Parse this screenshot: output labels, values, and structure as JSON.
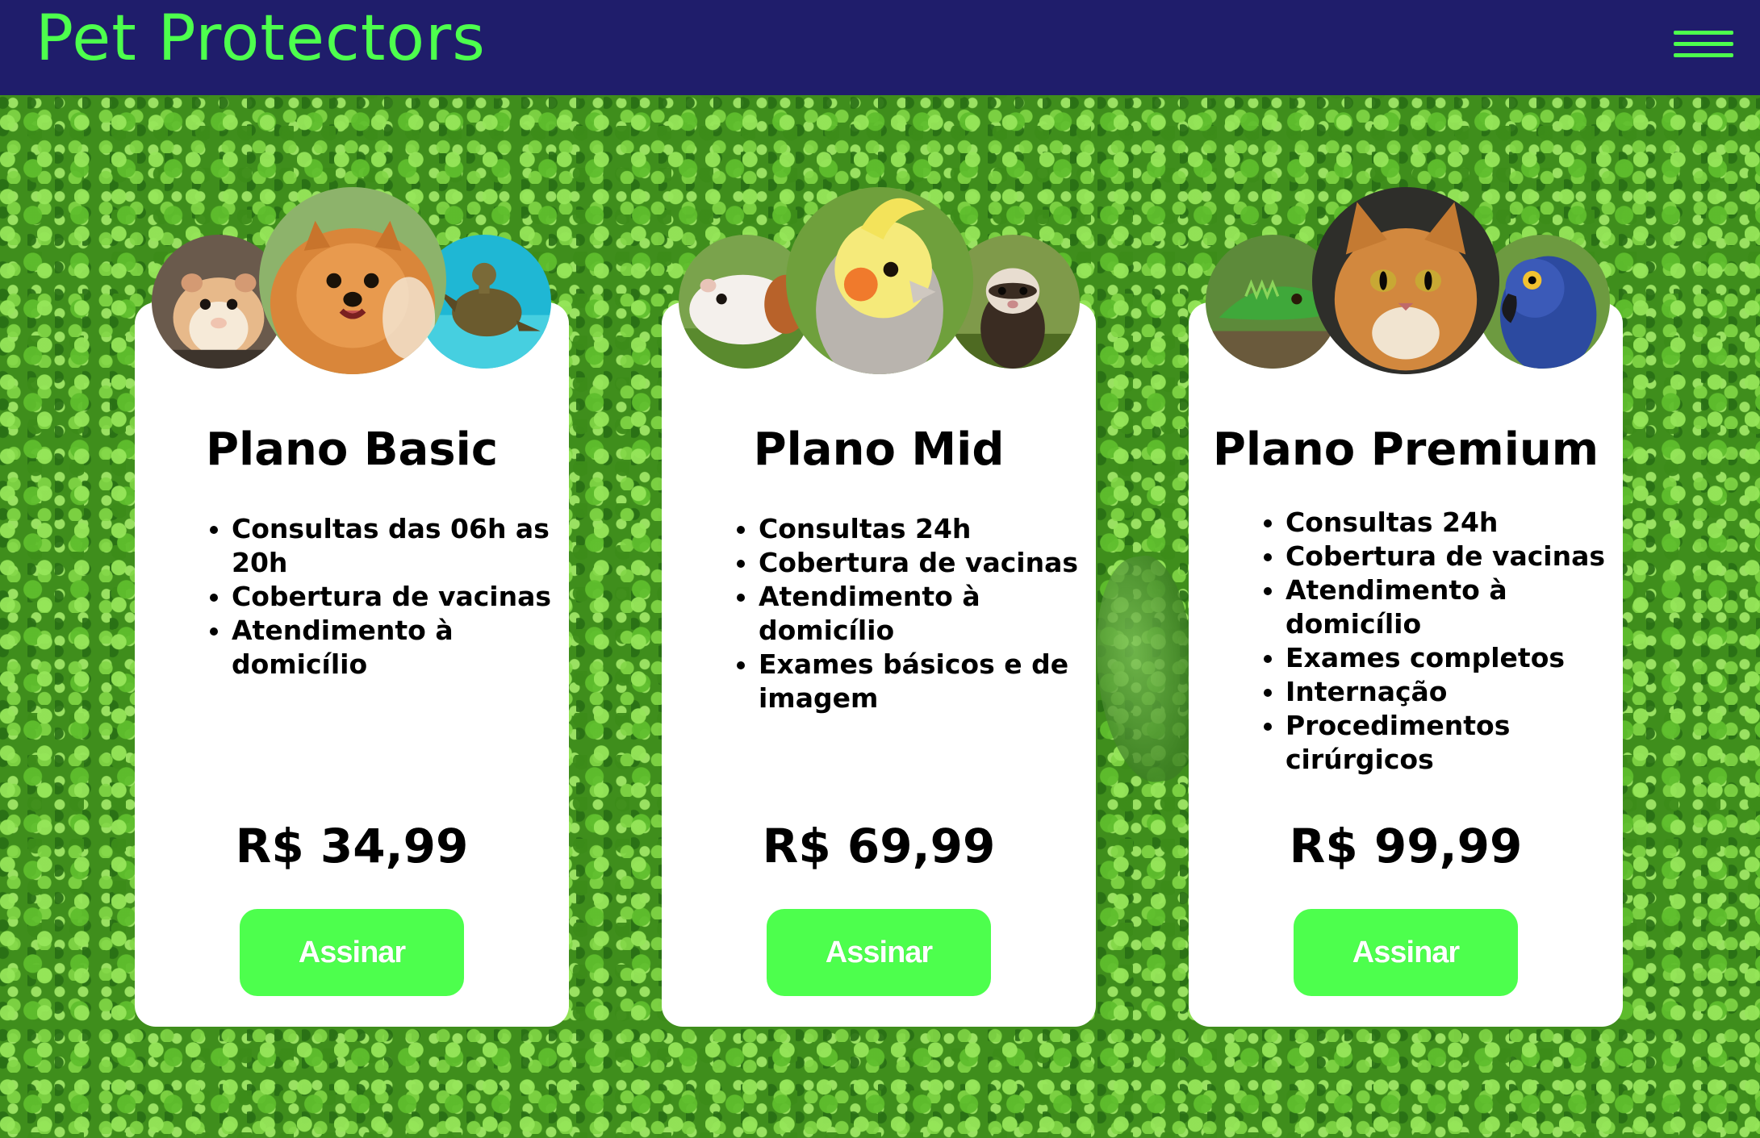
{
  "header": {
    "brand": "Pet Protectors",
    "menu_icon": "hamburger-menu-icon"
  },
  "theme": {
    "header_bg": "#1f1d6b",
    "accent_green": "#4dff4d",
    "card_bg": "#ffffff"
  },
  "plans": [
    {
      "title": "Plano Basic",
      "features": [
        "Consultas das 06h as 20h",
        "Cobertura de vacinas",
        "Atendimento à domicílio"
      ],
      "price": "R$ 34,99",
      "button_label": "Assinar",
      "animals": [
        "hamster",
        "pomeranian-dog",
        "sea-turtle"
      ]
    },
    {
      "title": "Plano Mid",
      "features": [
        "Consultas 24h",
        "Cobertura de vacinas",
        "Atendimento à domicílio",
        "Exames básicos e de imagem"
      ],
      "price": "R$ 69,99",
      "button_label": "Assinar",
      "animals": [
        "guinea-pig",
        "cockatiel",
        "ferret"
      ]
    },
    {
      "title": "Plano Premium",
      "features": [
        "Consultas 24h",
        "Cobertura de vacinas",
        "Atendimento à domicílio",
        "Exames completos",
        "Internação",
        "Procedimentos cirúrgicos"
      ],
      "price": "R$ 99,99",
      "button_label": "Assinar",
      "animals": [
        "iguana",
        "cat",
        "macaw"
      ]
    }
  ]
}
